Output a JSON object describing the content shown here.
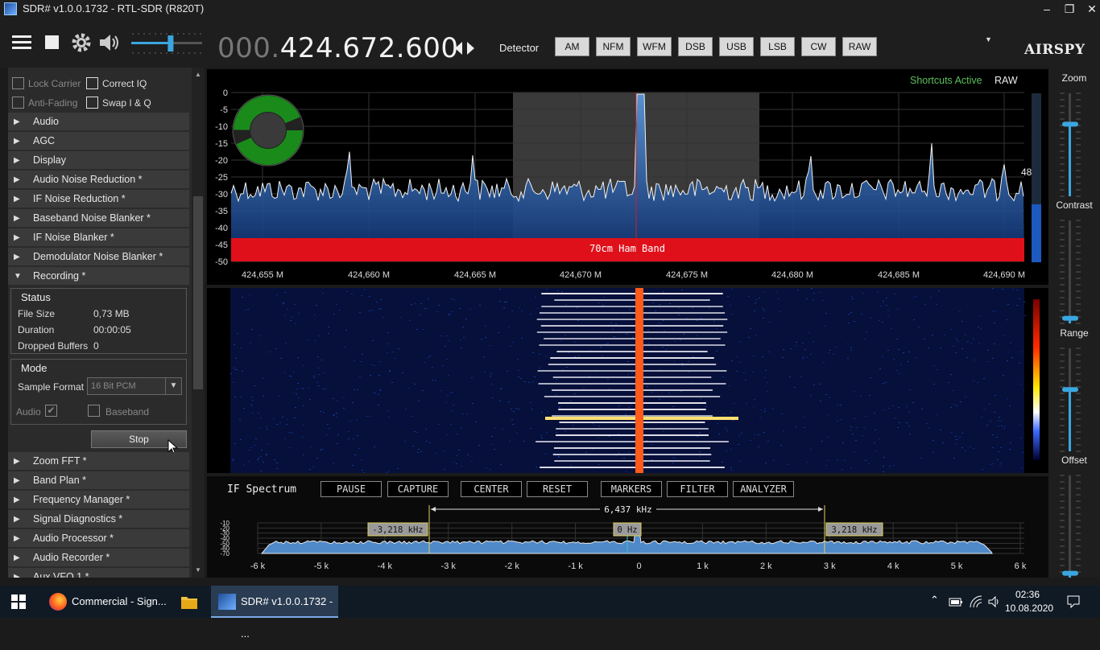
{
  "window": {
    "title": "SDR# v1.0.0.1732 - RTL-SDR (R820T)",
    "controls": [
      "–",
      "❐",
      "✕"
    ]
  },
  "toolbar": {
    "frequency_dim": "000.",
    "frequency_main": "424.672.600",
    "detector_label": "Detector",
    "modes": [
      "AM",
      "NFM",
      "WFM",
      "DSB",
      "USB",
      "LSB",
      "CW",
      "RAW"
    ],
    "brand": "AIRSPY",
    "volume_level": 0.55
  },
  "left_panel": {
    "top_options": [
      {
        "label": "Lock Carrier",
        "enabled": false
      },
      {
        "label": "Correct IQ",
        "enabled": true
      },
      {
        "label": "Anti-Fading",
        "enabled": false
      },
      {
        "label": "Swap I & Q",
        "enabled": true
      }
    ],
    "sections_before": [
      "Audio",
      "AGC",
      "Display",
      "Audio Noise Reduction *",
      "IF Noise Reduction *",
      "Baseband Noise Blanker *",
      "IF Noise Blanker *",
      "Demodulator Noise Blanker *"
    ],
    "recording": {
      "label": "Recording *",
      "status_title": "Status",
      "file_size_label": "File Size",
      "file_size": "0,73 MB",
      "duration_label": "Duration",
      "duration": "00:00:05",
      "dropped_label": "Dropped Buffers",
      "dropped": "0",
      "mode_title": "Mode",
      "sample_format_label": "Sample Format",
      "sample_format": "16 Bit PCM",
      "audio_label": "Audio",
      "baseband_label": "Baseband",
      "stop_label": "Stop"
    },
    "sections_after": [
      "Zoom FFT *",
      "Band Plan *",
      "Frequency Manager *",
      "Signal Diagnostics *",
      "Audio Processor *",
      "Audio Recorder *",
      "Aux VFO 1 *"
    ]
  },
  "spectrum": {
    "shortcuts": "Shortcuts Active",
    "mode": "RAW",
    "y_ticks": [
      "0",
      "-5",
      "-10",
      "-15",
      "-20",
      "-25",
      "-30",
      "-35",
      "-40",
      "-45",
      "-50"
    ],
    "x_ticks": [
      "424,655 M",
      "424,660 M",
      "424,665 M",
      "424,670 M",
      "424,675 M",
      "424,680 M",
      "424,685 M",
      "424,690 M"
    ],
    "band_label": "70cm Ham Band",
    "level": "48",
    "signal_meter_level": 0.5
  },
  "if_spectrum": {
    "title": "IF Spectrum",
    "buttons": [
      "PAUSE",
      "CAPTURE",
      "CENTER",
      "RESET",
      "MARKERS",
      "FILTER",
      "ANALYZER"
    ],
    "bandwidth": "6,437 kHz",
    "left_marker": "-3,218 kHz",
    "center_marker": "0 Hz",
    "right_marker": "3,218 kHz",
    "y_ticks": [
      "-10",
      "-20",
      "-30",
      "-40",
      "-50",
      "-60",
      "-70"
    ],
    "x_ticks": [
      "-6 k",
      "-5 k",
      "-4 k",
      "-3 k",
      "-2 k",
      "-1 k",
      "0",
      "1 k",
      "2 k",
      "3 k",
      "4 k",
      "5 k",
      "6 k"
    ]
  },
  "right_panel": {
    "sliders": [
      {
        "label": "Zoom",
        "level": 0.7
      },
      {
        "label": "Contrast",
        "level": 0.05
      },
      {
        "label": "Range",
        "level": 0.6
      },
      {
        "label": "Offset",
        "level": 0.05
      }
    ]
  },
  "taskbar": {
    "items": [
      "Commercial - Sign...",
      "SDR# v1.0.0.1732 - ..."
    ],
    "time": "02:36",
    "date": "10.08.2020"
  },
  "colors": {
    "spectrum_fill": "#1f5fb0",
    "band_red": "#e0101a",
    "tuning_line": "#cc2222"
  }
}
